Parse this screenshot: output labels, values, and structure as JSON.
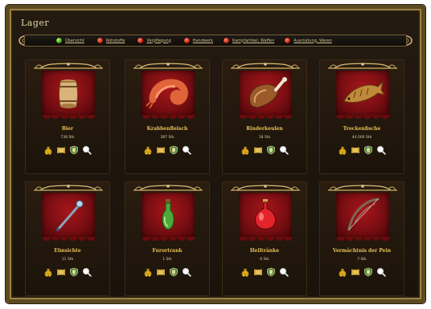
{
  "window": {
    "title": "Lager"
  },
  "tabs": [
    {
      "label": "Übersicht",
      "status": "green"
    },
    {
      "label": "Rohstoffe",
      "status": "red"
    },
    {
      "label": "Verpflegung",
      "status": "red"
    },
    {
      "label": "Handwerk",
      "status": "red"
    },
    {
      "label": "Kampfartikel, Waffen",
      "status": "red"
    },
    {
      "label": "Ausrüstung, Waren",
      "status": "red"
    }
  ],
  "items": [
    {
      "name": "Bier",
      "price": "738 Stk",
      "icon": "barrel-icon"
    },
    {
      "name": "Krabbenfleisch",
      "price": "387 Stk",
      "icon": "shrimp-icon"
    },
    {
      "name": "Rinderkeulen",
      "price": "18 Stk",
      "icon": "meat-leg-icon"
    },
    {
      "name": "Trockenfische",
      "price": "44.000 Stk",
      "icon": "dried-fish-icon"
    },
    {
      "name": "Elmsichte",
      "price": "11 Stk",
      "icon": "wand-icon"
    },
    {
      "name": "Furortrank",
      "price": "1 Stk",
      "icon": "green-potion-icon"
    },
    {
      "name": "Heiltränke",
      "price": "6 Stk",
      "icon": "red-potion-icon"
    },
    {
      "name": "Vermächtnis der Pein",
      "price": "7 Stk",
      "icon": "bow-icon"
    }
  ],
  "actions": [
    "gold-sack-icon",
    "scroll-icon",
    "shield-crest-icon",
    "magnifier-icon"
  ]
}
